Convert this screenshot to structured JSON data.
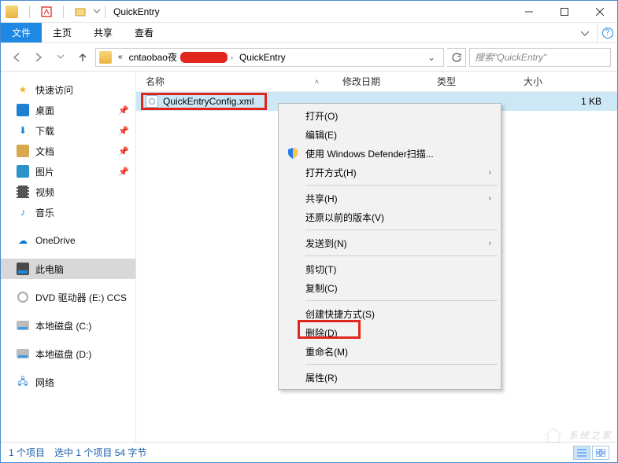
{
  "window": {
    "title": "QuickEntry"
  },
  "ribbon": {
    "file": "文件",
    "home": "主页",
    "share": "共享",
    "view": "查看"
  },
  "breadcrumb": {
    "parent": "cntaobao夜",
    "current": "QuickEntry"
  },
  "search": {
    "placeholder": "搜索\"QuickEntry\""
  },
  "columns": {
    "name": "名称",
    "date": "修改日期",
    "type": "类型",
    "size": "大小"
  },
  "file": {
    "name": "QuickEntryConfig.xml",
    "size": "1 KB"
  },
  "sidebar": {
    "quick": "快速访问",
    "desktop": "桌面",
    "downloads": "下载",
    "documents": "文档",
    "pictures": "图片",
    "videos": "视频",
    "music": "音乐",
    "onedrive": "OneDrive",
    "thispc": "此电脑",
    "dvd": "DVD 驱动器 (E:) CCS",
    "diskc": "本地磁盘 (C:)",
    "diskd": "本地磁盘 (D:)",
    "network": "网络"
  },
  "context": {
    "open": "打开(O)",
    "edit": "编辑(E)",
    "defender": "使用 Windows Defender扫描...",
    "openwith": "打开方式(H)",
    "share": "共享(H)",
    "restore": "还原以前的版本(V)",
    "sendto": "发送到(N)",
    "cut": "剪切(T)",
    "copy": "复制(C)",
    "shortcut": "创建快捷方式(S)",
    "delete": "删除(D)",
    "rename": "重命名(M)",
    "properties": "属性(R)"
  },
  "status": {
    "count": "1 个项目",
    "selected": "选中 1 个项目  54 字节"
  },
  "watermark": "系统之家"
}
